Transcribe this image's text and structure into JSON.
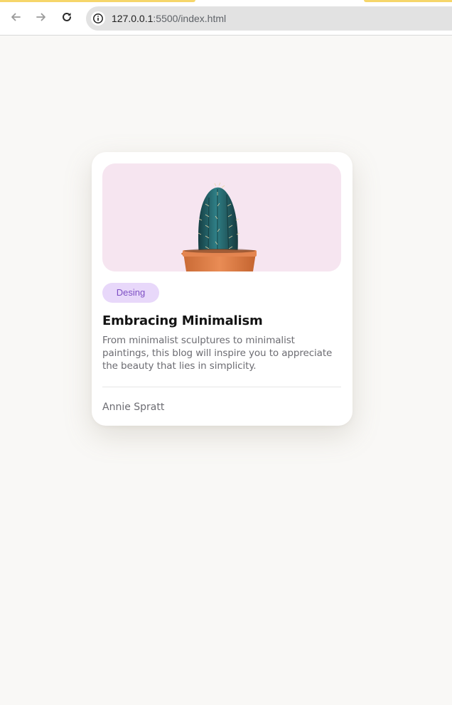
{
  "browser": {
    "url_host": "127.0.0.1",
    "url_path": ":5500/index.html",
    "back_icon": "arrow-left-icon",
    "forward_icon": "arrow-right-icon",
    "reload_icon": "reload-icon",
    "site_info_icon": "info-icon",
    "accent_color": "#f6d66a"
  },
  "card": {
    "image_icon": "cactus-in-pot-image",
    "image_background": "#f6e5f0",
    "tag": "Desing",
    "tag_color": "#7d4fc4",
    "tag_background": "#e8d8fa",
    "title": "Embracing Minimalism",
    "description": "From minimalist sculptures to minimalist paintings, this blog will inspire you to appreciate the beauty that lies in simplicity.",
    "author": "Annie Spratt"
  }
}
